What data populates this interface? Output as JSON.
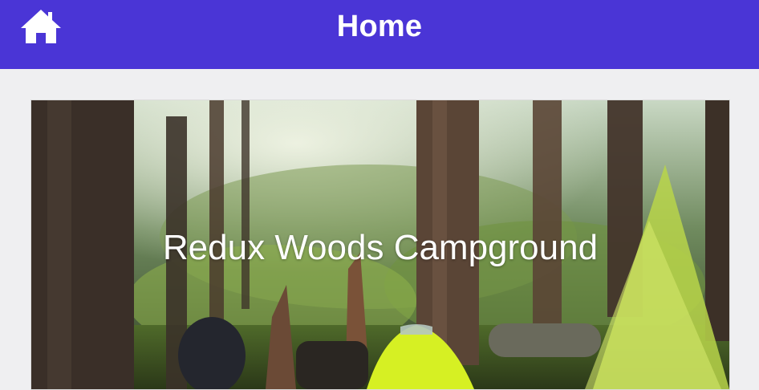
{
  "header": {
    "title": "Home",
    "home_icon": "home-icon",
    "background_color": "#4a35d6"
  },
  "main": {
    "cards": [
      {
        "title": "Redux Woods Campground"
      }
    ]
  }
}
